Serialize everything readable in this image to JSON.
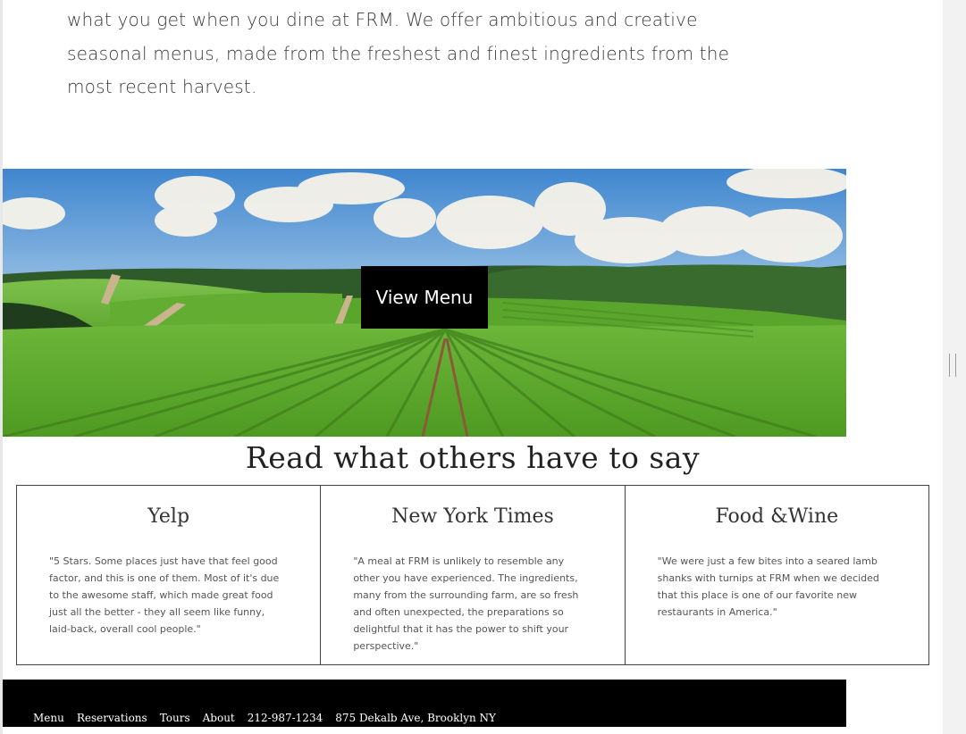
{
  "intro": {
    "text": "what you get when you dine at FRM. We offer ambitious and creative seasonal menus, made from the freshest and finest ingredients from the most recent harvest."
  },
  "hero": {
    "button_label": "View Menu"
  },
  "reviews": {
    "title": "Read what others have to say",
    "items": [
      {
        "source": "Yelp",
        "quote": "\"5 Stars. Some places just have that feel good factor, and this is one of them. Most of it's due to the awesome staff, which made great food just all the better - they all seem like funny, laid-back, overall cool people.\""
      },
      {
        "source": "New York Times",
        "quote": "\"A meal at FRM is unlikely to resemble any other you have experienced. The ingredients, many from the surrounding farm, are so fresh and often unexpected, the preparations so delightful that it has the power to shift your perspective.\""
      },
      {
        "source": "Food &Wine",
        "quote": "\"We were just a few bites into a seared lamb shanks with turnips at FRM when we decided that this place is one of our favorite new restaurants in America.\""
      }
    ]
  },
  "footer": {
    "menu": "Menu",
    "reservations": "Reservations",
    "tours": "Tours",
    "about": "About",
    "phone": "212-987-1234",
    "address": "875 Dekalb Ave, Brooklyn NY"
  },
  "colors": {
    "footer_bg": "#000000",
    "button_bg": "#000000",
    "sky": "#4a8fd4",
    "grass": "#5aa52c"
  }
}
